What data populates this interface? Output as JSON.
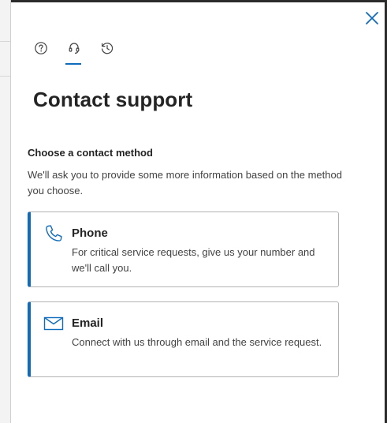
{
  "panel": {
    "title": "Contact support",
    "close_icon": "close-icon",
    "tabs": [
      {
        "name": "help",
        "icon": "help-circle-icon",
        "selected": false
      },
      {
        "name": "contact-support",
        "icon": "headset-icon",
        "selected": true
      },
      {
        "name": "history",
        "icon": "history-icon",
        "selected": false
      }
    ]
  },
  "section": {
    "label": "Choose a contact method",
    "description": "We'll ask you to provide some more information based on the method you choose."
  },
  "methods": [
    {
      "title": "Phone",
      "description": "For critical service requests, give us your number and we'll call you.",
      "icon": "phone-icon"
    },
    {
      "title": "Email",
      "description": "Connect with us through email and the service request.",
      "icon": "mail-icon"
    }
  ],
  "colors": {
    "accent": "#0f6cbd",
    "text": "#242424",
    "secondary_text": "#424242",
    "card_border": "#b3b3b3"
  }
}
